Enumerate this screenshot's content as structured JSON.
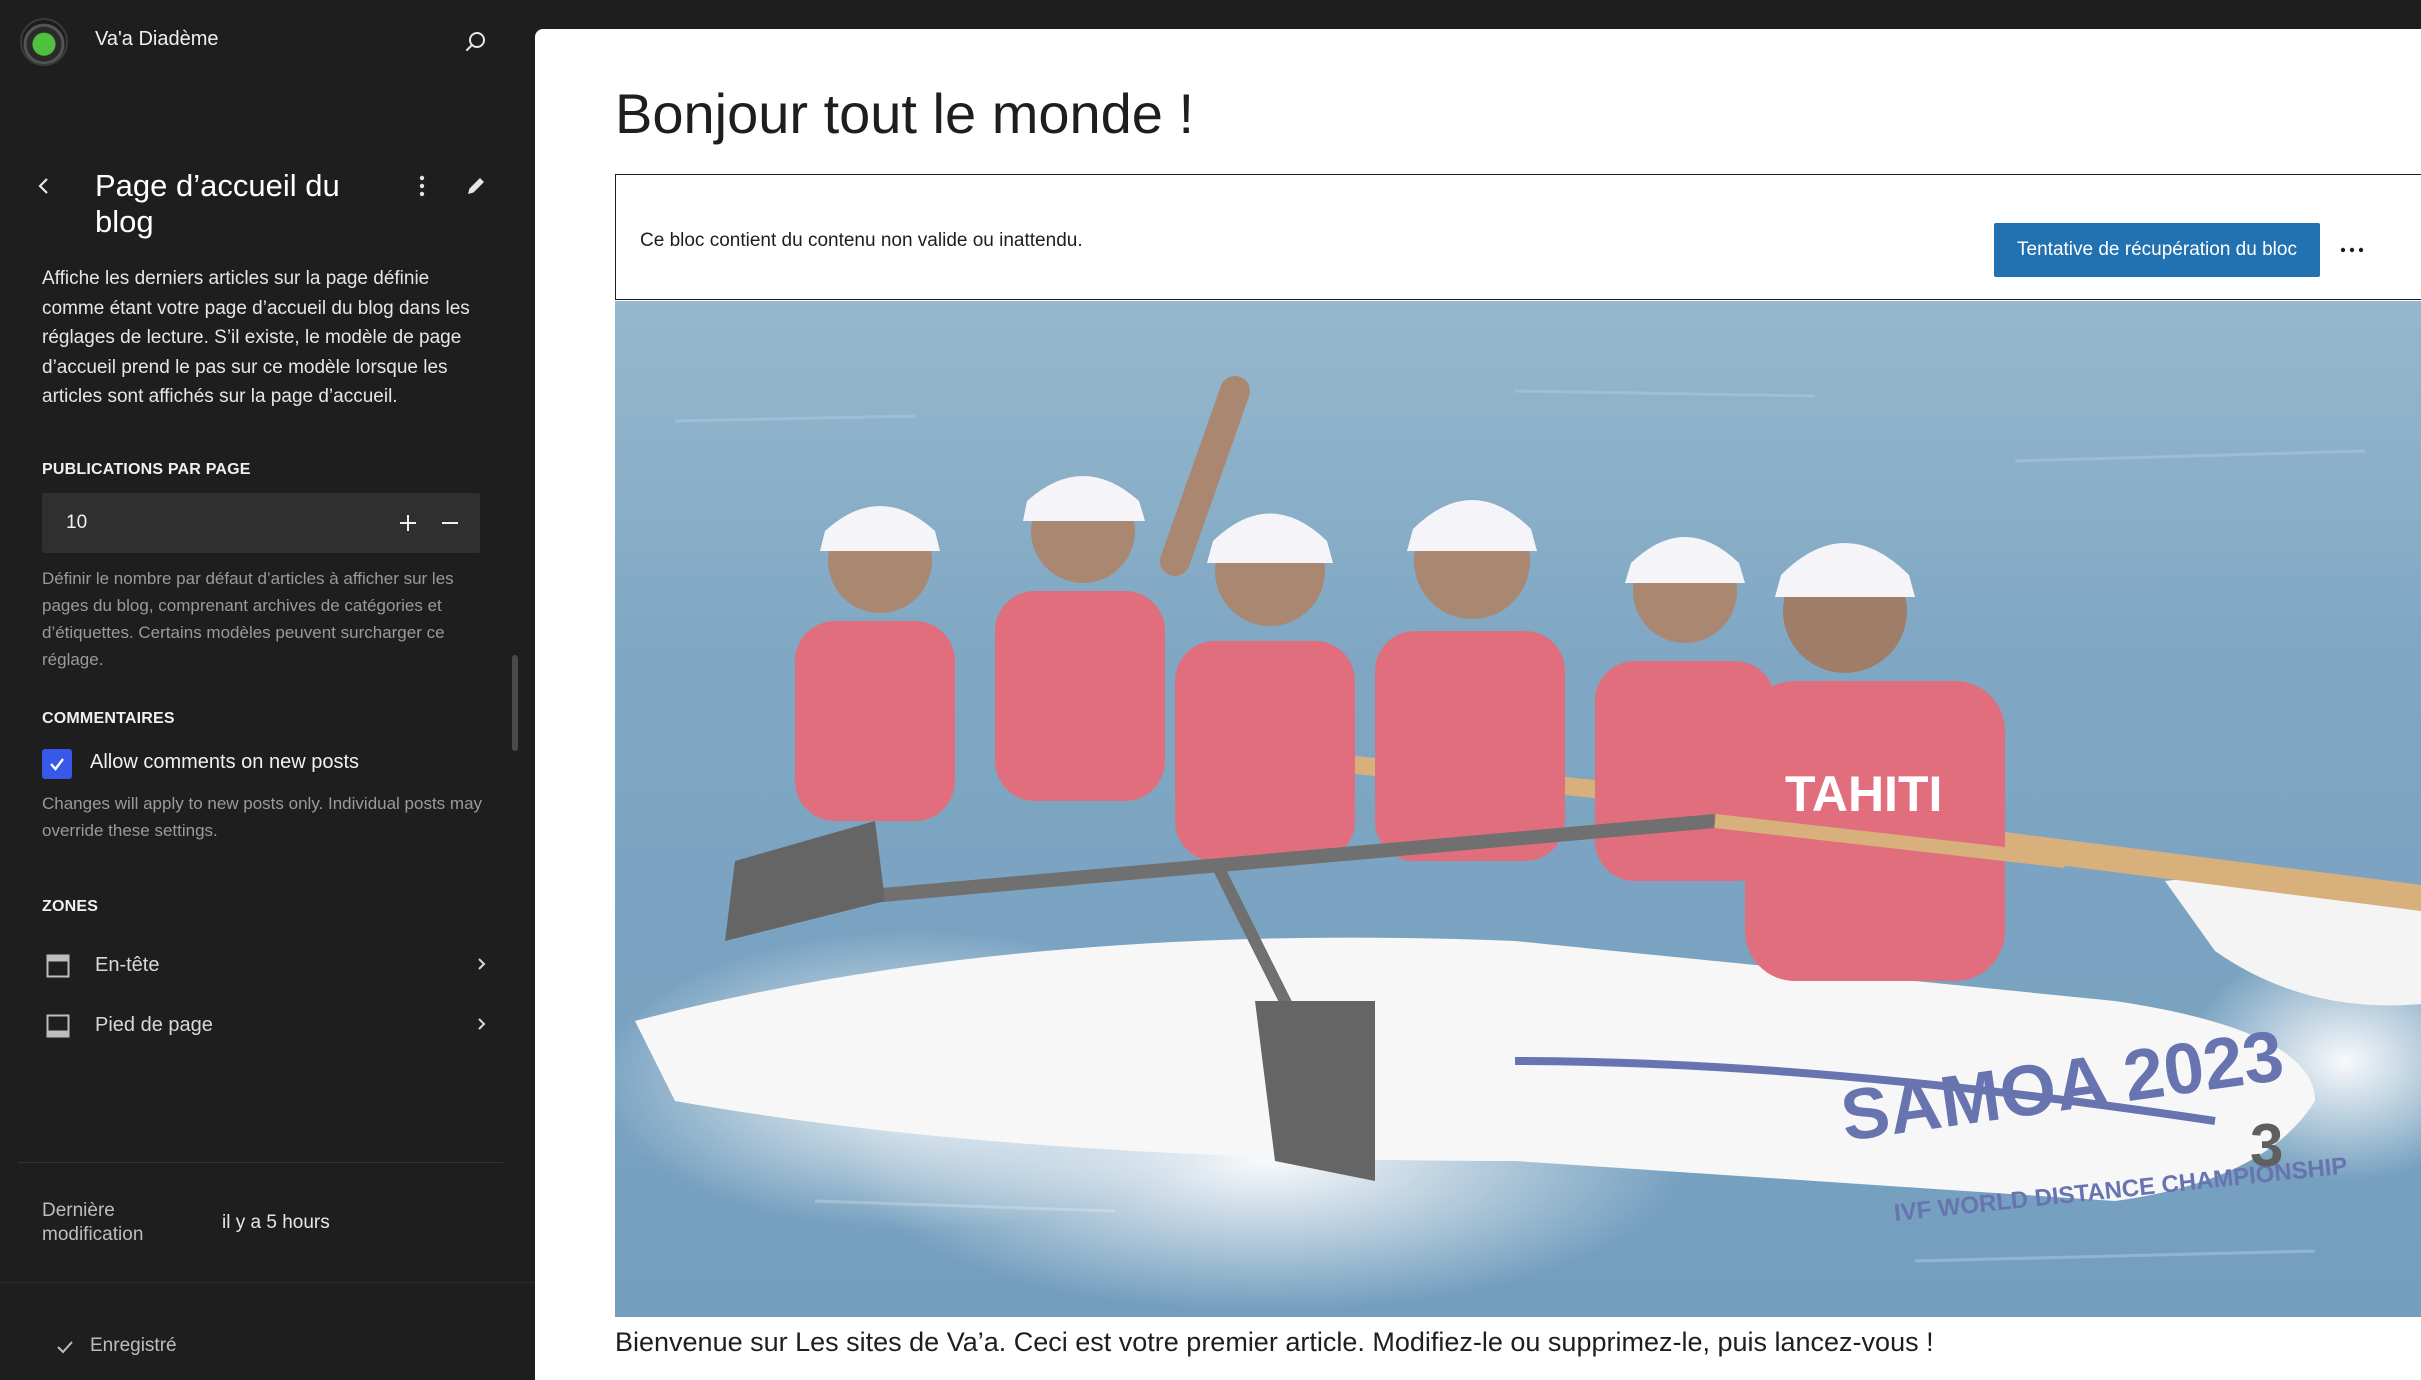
{
  "sidebar": {
    "site_name": "Va'a Diadème",
    "panel_title": "Page d’accueil du blog",
    "description": "Affiche les derniers articles sur la page définie comme étant votre page d’accueil du blog dans les réglages de lecture. S’il existe, le modèle de page d’accueil prend le pas sur ce modèle lorsque les articles sont affichés sur la page d’accueil.",
    "posts_per_page": {
      "label": "PUBLICATIONS PAR PAGE",
      "value": "10",
      "help": "Définir le nombre par défaut d’articles à afficher sur les pages du blog, comprenant archives de catégories et d’étiquettes. Certains modèles peuvent surcharger ce réglage."
    },
    "comments": {
      "label": "COMMENTAIRES",
      "checkbox_label": "Allow comments on new posts",
      "checked": true,
      "help": "Changes will apply to new posts only. Individual posts may override these settings."
    },
    "zones": {
      "label": "ZONES",
      "items": [
        {
          "label": "En-tête",
          "icon": "header-layout-icon"
        },
        {
          "label": "Pied de page",
          "icon": "footer-layout-icon"
        }
      ]
    },
    "last_modified": {
      "label": "Dernière modification",
      "value": "il y a 5 hours"
    },
    "save_status": "Enregistré",
    "accent_color": "#3858e9"
  },
  "canvas": {
    "post_title": "Bonjour tout le monde !",
    "invalid_block": {
      "message": "Ce bloc contient du contenu non valide ou inattendu.",
      "recover_label": "Tentative de récupération du bloc"
    },
    "image_text": {
      "boat_number": "3",
      "boat_label": "SAMOA 2023",
      "boat_subtitle": "IVF WORLD DISTANCE CHAMPIONSHIP",
      "jersey": "TAHITI"
    },
    "post_text": "Bienvenue sur Les sites de Va’a. Ceci est votre premier article. Modifiez-le ou supprimez-le, puis lancez-vous !",
    "button_color": "#2271b1"
  }
}
